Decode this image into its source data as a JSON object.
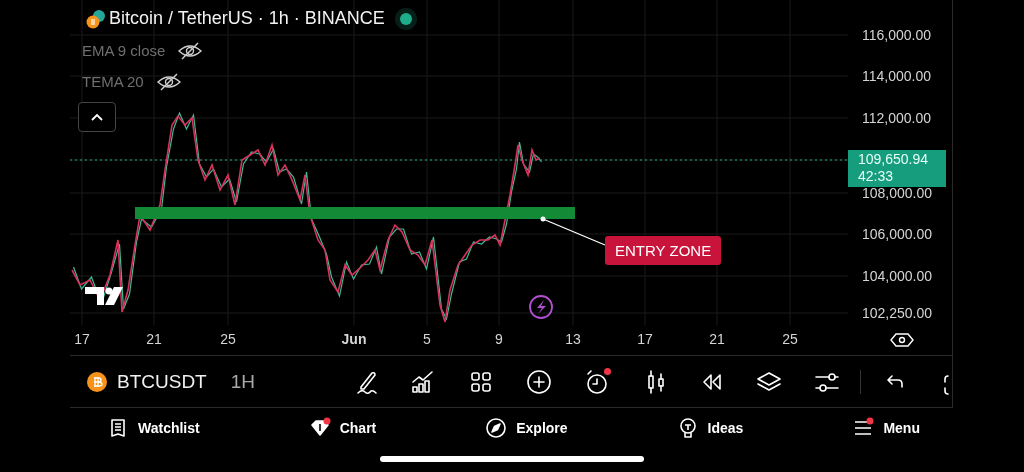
{
  "header": {
    "title": "Bitcoin / TetherUS · 1h · BINANCE",
    "live": true
  },
  "indicators": [
    {
      "label": "EMA 9 close",
      "hidden": true
    },
    {
      "label": "TEMA 20",
      "hidden": true
    }
  ],
  "price_axis": [
    "116,000.00",
    "114,000.00",
    "112,000.00",
    "108,000.00",
    "106,000.00",
    "104,000.00",
    "102,250.00"
  ],
  "price_tag": {
    "price": "109,650.94",
    "countdown": "42:33"
  },
  "date_axis": [
    {
      "label": "17",
      "bold": false
    },
    {
      "label": "21",
      "bold": false
    },
    {
      "label": "25",
      "bold": false
    },
    {
      "label": "Jun",
      "bold": true
    },
    {
      "label": "5",
      "bold": false
    },
    {
      "label": "9",
      "bold": false
    },
    {
      "label": "13",
      "bold": false
    },
    {
      "label": "17",
      "bold": false
    },
    {
      "label": "21",
      "bold": false
    },
    {
      "label": "25",
      "bold": false
    }
  ],
  "annotation": {
    "text": "ENTRY ZONE"
  },
  "toolbar": {
    "symbol": "BTCUSDT",
    "interval": "1H",
    "tools": [
      {
        "kind": "draw",
        "badge": false
      },
      {
        "kind": "indicators",
        "badge": false
      },
      {
        "kind": "templates",
        "badge": false
      },
      {
        "kind": "add",
        "badge": false
      },
      {
        "kind": "alert",
        "badge": true
      },
      {
        "kind": "candles",
        "badge": false
      },
      {
        "kind": "replay",
        "badge": false
      },
      {
        "kind": "layers",
        "badge": false
      },
      {
        "kind": "settings",
        "badge": false
      },
      {
        "kind": "undo",
        "badge": false
      },
      {
        "kind": "fullscreen",
        "badge": false
      }
    ]
  },
  "bottom_nav": [
    {
      "kind": "watchlist",
      "label": "Watchlist",
      "badge": false
    },
    {
      "kind": "chart",
      "label": "Chart",
      "badge": true
    },
    {
      "kind": "explore",
      "label": "Explore",
      "badge": false
    },
    {
      "kind": "ideas",
      "label": "Ideas",
      "badge": false
    },
    {
      "kind": "menu",
      "label": "Menu",
      "badge": true
    }
  ]
}
